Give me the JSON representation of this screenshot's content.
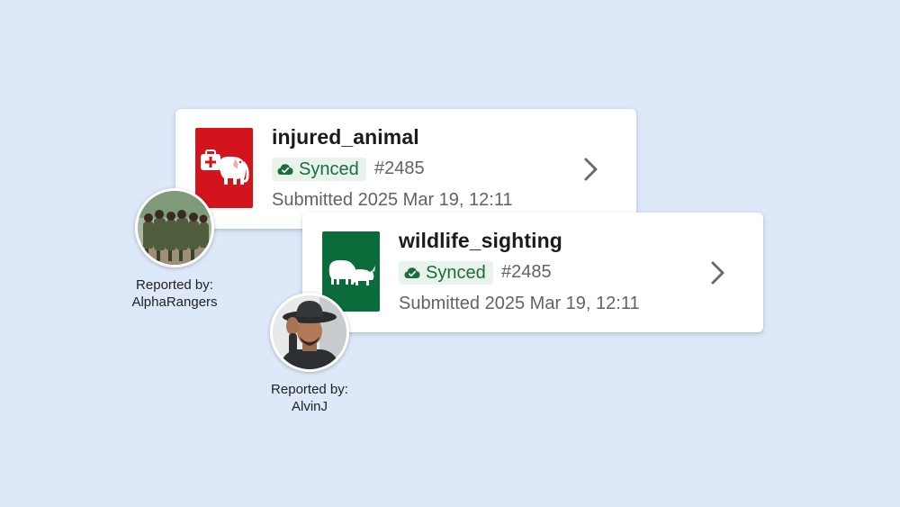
{
  "colors": {
    "background": "#dde8f8",
    "injured_thumb": "#d4141c",
    "sighting_thumb": "#0b6b3a",
    "synced_text": "#1e6b3f",
    "synced_bg": "#e8f3ec"
  },
  "cards": [
    {
      "title": "injured_animal",
      "status": "Synced",
      "status_icon": "cloud-check-icon",
      "ref": "#2485",
      "submitted": "Submitted 2025 Mar 19, 12:11",
      "thumb_icon": "elephant-medical-icon",
      "reporter_label": "Reported by:",
      "reporter_name": "AlphaRangers"
    },
    {
      "title": "wildlife_sighting",
      "status": "Synced",
      "status_icon": "cloud-check-icon",
      "ref": "#2485",
      "submitted": "Submitted 2025 Mar 19, 12:11",
      "thumb_icon": "elephant-rhino-icon",
      "reporter_label": "Reported by:",
      "reporter_name": "AlvinJ"
    }
  ]
}
